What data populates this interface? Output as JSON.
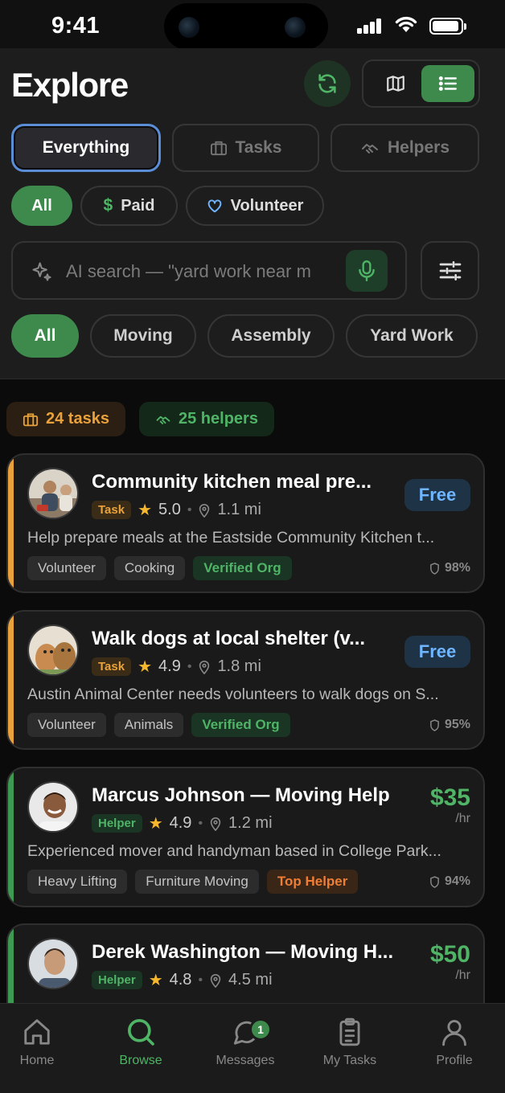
{
  "status_bar": {
    "time": "9:41"
  },
  "header": {
    "title": "Explore",
    "segments": [
      {
        "label": "Everything",
        "active": true
      },
      {
        "label": "Tasks",
        "icon": "briefcase-icon"
      },
      {
        "label": "Helpers",
        "icon": "handshake-icon"
      }
    ],
    "pay_filters": [
      {
        "label": "All",
        "active": true
      },
      {
        "label": "Paid",
        "icon": "dollar-icon"
      },
      {
        "label": "Volunteer",
        "icon": "heart-icon"
      }
    ],
    "search": {
      "placeholder": "AI search — \"yard work near m",
      "value": ""
    },
    "categories": [
      {
        "label": "All",
        "active": true
      },
      {
        "label": "Moving"
      },
      {
        "label": "Assembly"
      },
      {
        "label": "Yard Work"
      }
    ]
  },
  "summary": {
    "tasks": "24 tasks",
    "helpers": "25 helpers"
  },
  "cards": [
    {
      "kind": "task",
      "title": "Community kitchen meal pre...",
      "type_label": "Task",
      "rating": "5.0",
      "distance": "1.1 mi",
      "price": "Free",
      "description": "Help prepare meals at the Eastside Community Kitchen t...",
      "tags": [
        "Volunteer",
        "Cooking",
        "Verified Org"
      ],
      "match": "98%"
    },
    {
      "kind": "task",
      "title": "Walk dogs at local shelter (v...",
      "type_label": "Task",
      "rating": "4.9",
      "distance": "1.8 mi",
      "price": "Free",
      "description": "Austin Animal Center needs volunteers to walk dogs on S...",
      "tags": [
        "Volunteer",
        "Animals",
        "Verified Org"
      ],
      "match": "95%"
    },
    {
      "kind": "helper",
      "title": "Marcus Johnson — Moving Help",
      "type_label": "Helper",
      "rating": "4.9",
      "distance": "1.2 mi",
      "price": "$35",
      "price_unit": "/hr",
      "description": "Experienced mover and handyman based in College Park...",
      "tags": [
        "Heavy Lifting",
        "Furniture Moving",
        "Top Helper"
      ],
      "match": "94%"
    },
    {
      "kind": "helper",
      "title": "Derek Washington — Moving H...",
      "type_label": "Helper",
      "rating": "4.8",
      "distance": "4.5 mi",
      "price": "$50",
      "price_unit": "/hr"
    }
  ],
  "tabbar": {
    "items": [
      {
        "label": "Home",
        "icon": "home-icon"
      },
      {
        "label": "Browse",
        "icon": "search-icon",
        "active": true
      },
      {
        "label": "Messages",
        "icon": "chat-bubble-icon",
        "badge": "1"
      },
      {
        "label": "My Tasks",
        "icon": "clipboard-icon"
      },
      {
        "label": "Profile",
        "icon": "person-icon"
      }
    ]
  },
  "colors": {
    "accent_green": "#3e8a4d",
    "task_orange": "#e9a23b",
    "free_blue": "#6fb5ff",
    "top_helper_orange": "#ef7e34"
  }
}
